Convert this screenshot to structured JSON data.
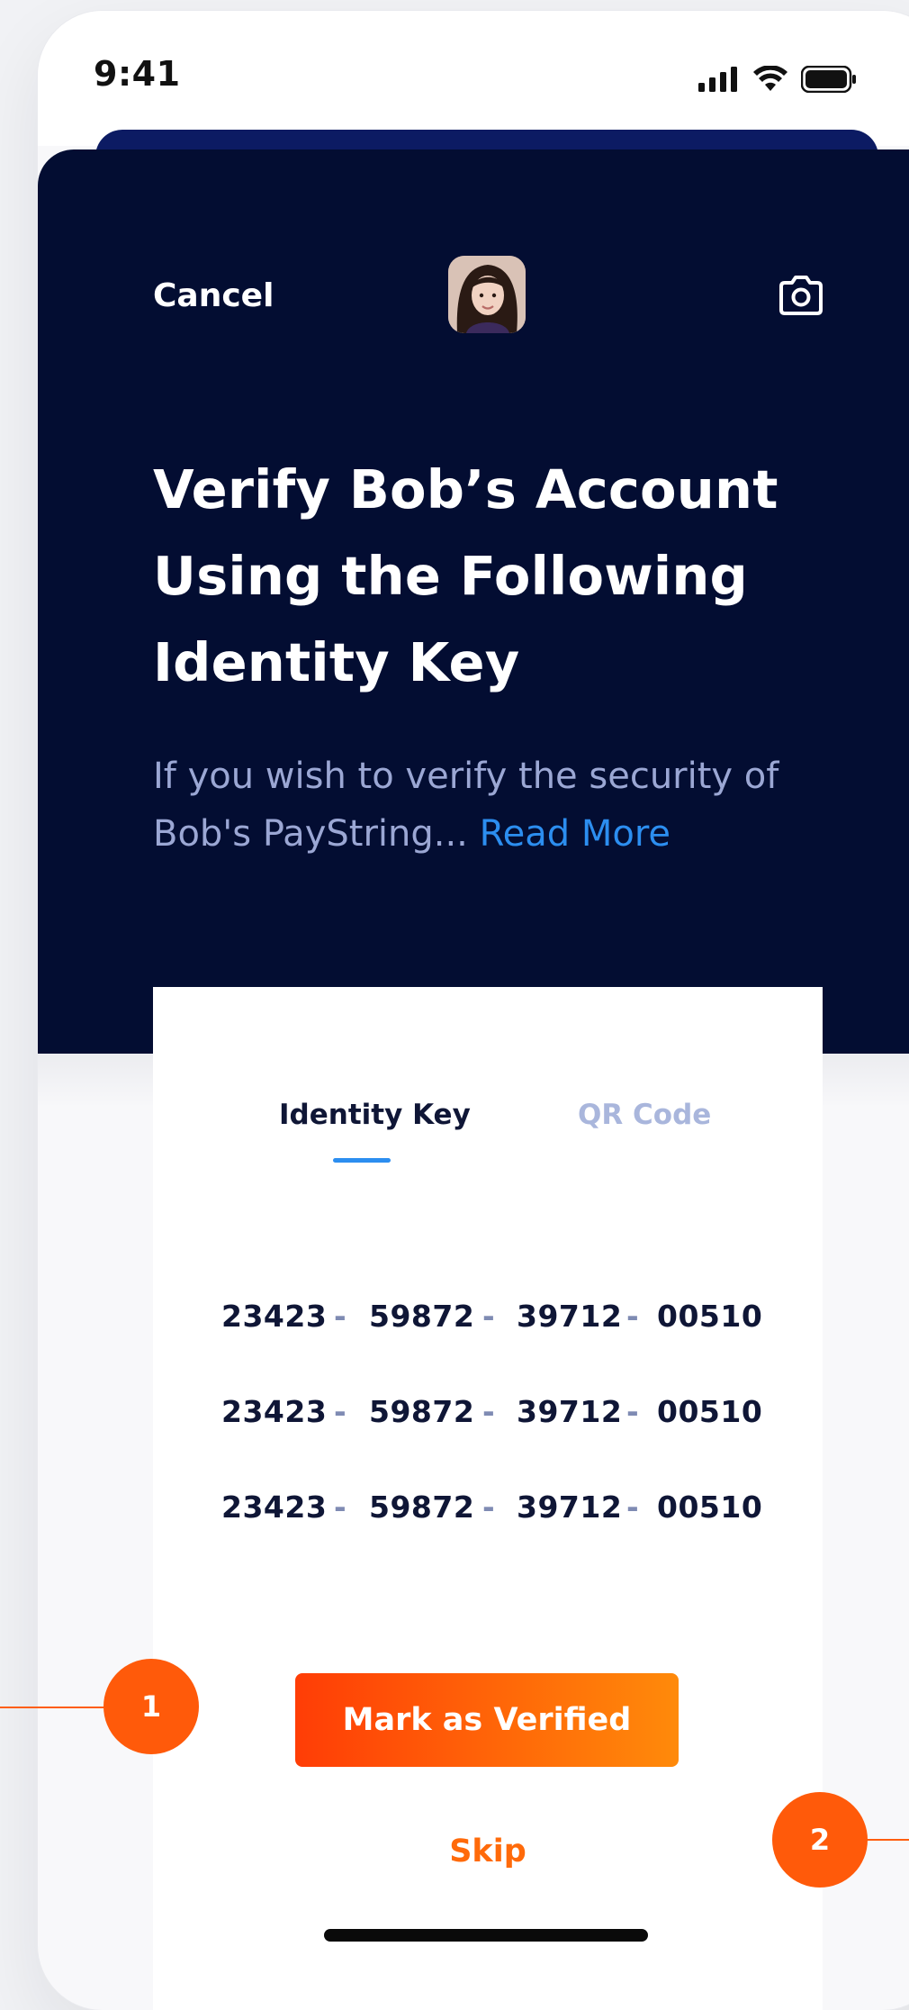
{
  "status_bar": {
    "time": "9:41"
  },
  "header": {
    "cancel_label": "Cancel",
    "avatar_icon": "user-avatar-icon",
    "camera_icon": "camera-icon"
  },
  "hero": {
    "title_line1": "Verify Bob’s Account",
    "title_line2": "Using the Following",
    "title_line3": "Identity Key",
    "description_line1": "If you wish to verify the security of",
    "description_line2": "Bob's PayString... ",
    "read_more_label": "Read More"
  },
  "tabs": [
    {
      "label": "Identity Key",
      "active": true
    },
    {
      "label": "QR Code",
      "active": false
    }
  ],
  "identity_key": {
    "rows": [
      [
        "23423",
        "59872",
        "39712",
        "00510"
      ],
      [
        "23423",
        "59872",
        "39712",
        "00510"
      ],
      [
        "23423",
        "59872",
        "39712",
        "00510"
      ]
    ],
    "separator": "-"
  },
  "actions": {
    "verify_label": "Mark as Verified",
    "skip_label": "Skip"
  },
  "annotations": [
    {
      "label": "1"
    },
    {
      "label": "2"
    }
  ],
  "colors": {
    "sheet_background": "#030d32",
    "accent_blue": "#2c8ef0",
    "accent_orange": "#ff5a0a",
    "muted_text": "#9ba7d4"
  }
}
